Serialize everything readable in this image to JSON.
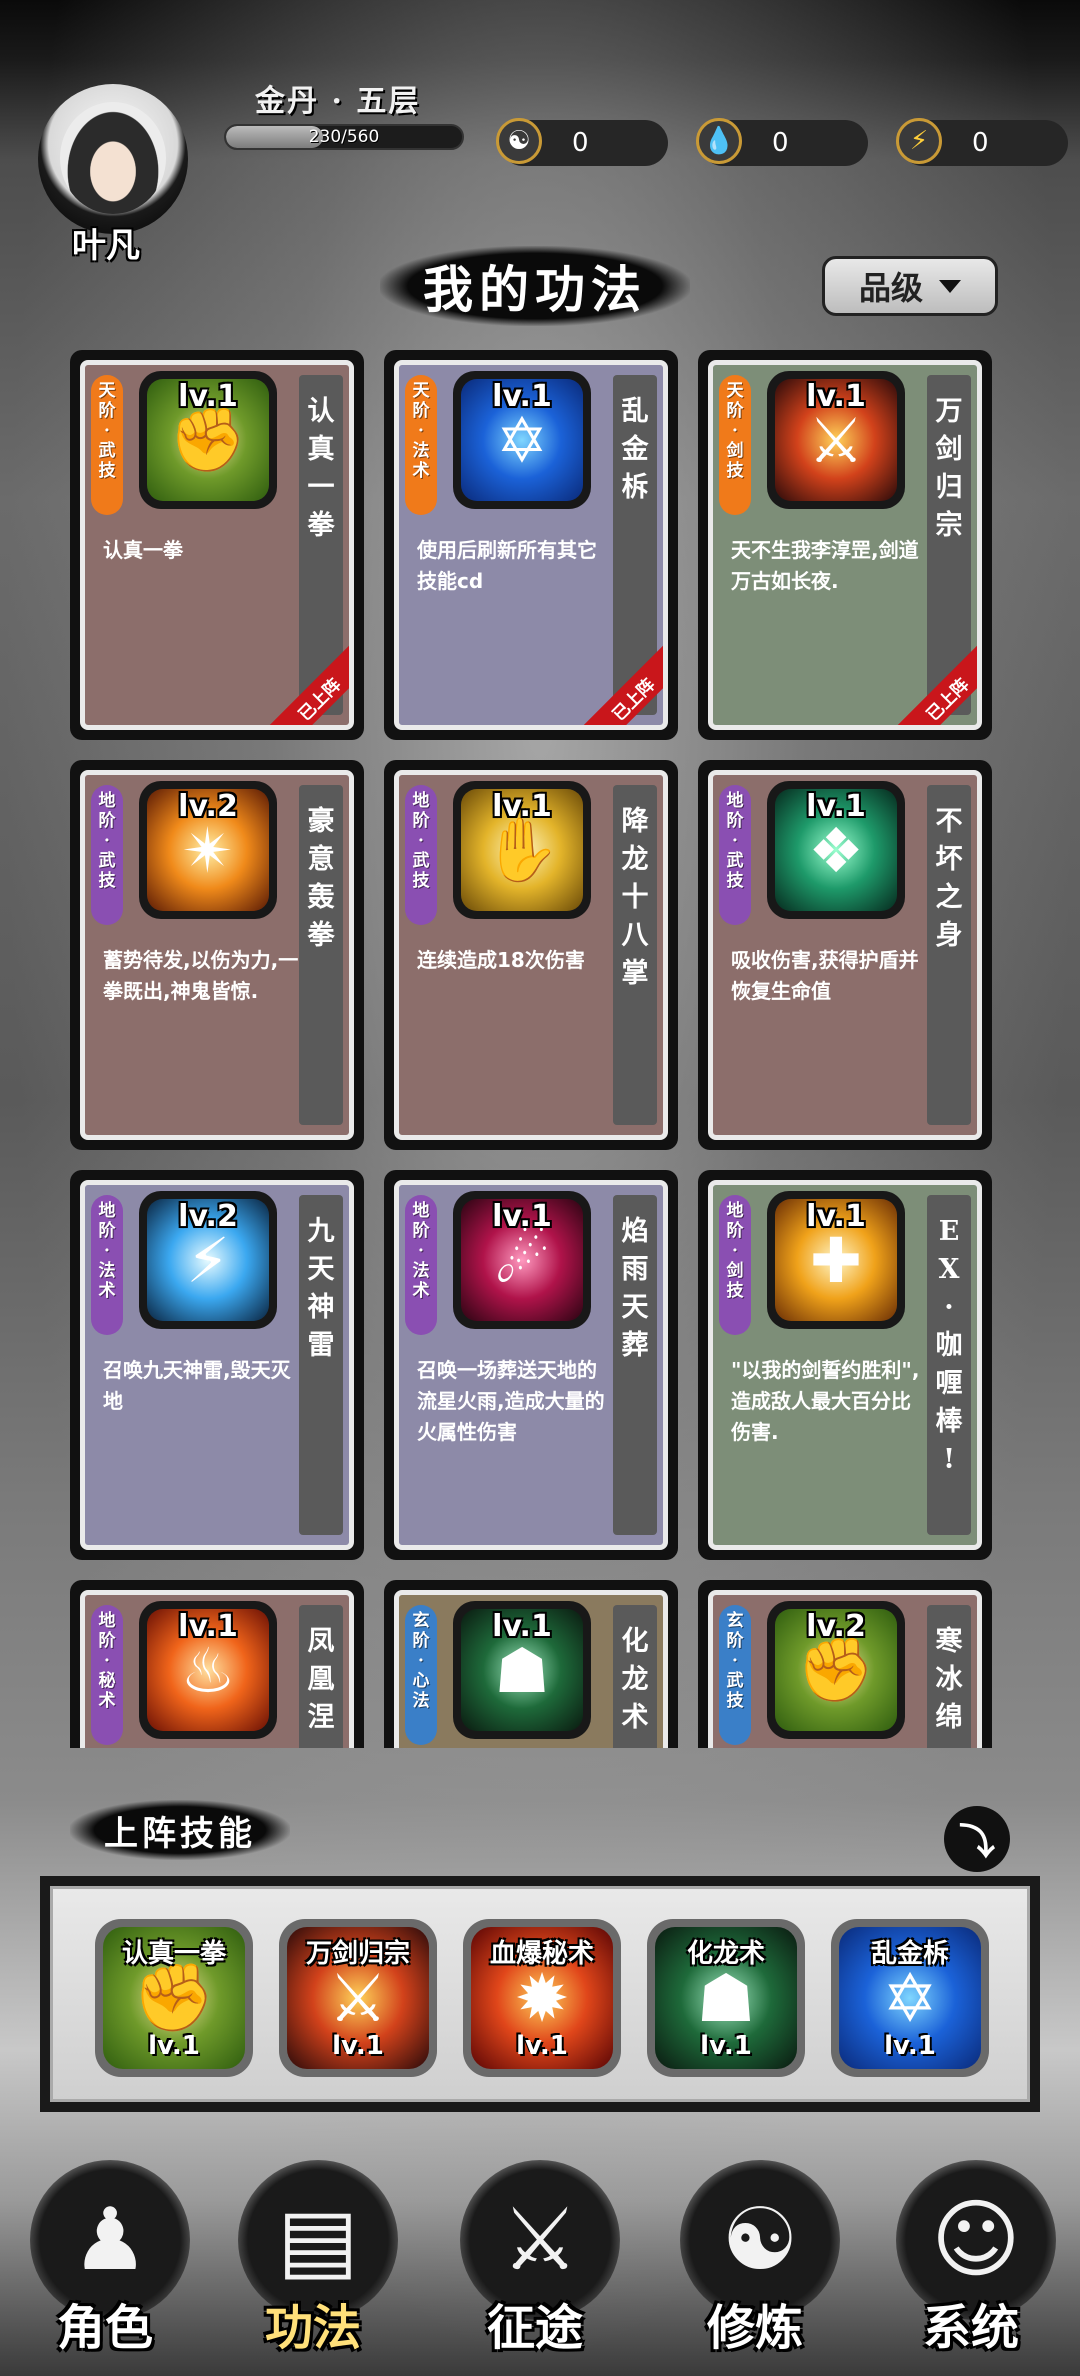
{
  "player": {
    "name": "叶凡",
    "realm": "金丹 · 五层",
    "exp_text": "230/560",
    "exp_fraction": 0.41
  },
  "currencies": [
    {
      "icon": "yin-yang-icon",
      "value": "0"
    },
    {
      "icon": "water-drop-icon",
      "value": "0"
    },
    {
      "icon": "lightning-icon",
      "value": "0"
    }
  ],
  "page": {
    "title": "我的功法",
    "sort_label": "品级"
  },
  "skills": [
    {
      "grade": [
        "天",
        "阶",
        "·",
        "武",
        "技"
      ],
      "grade_color": "#f07a1a",
      "bg": "#8c6e6b",
      "name": [
        "认",
        "真",
        "一",
        "拳"
      ],
      "level": "lv.1",
      "desc": "认真一拳",
      "icon": "fist-icon",
      "art": [
        "#f4e6a0",
        "#6f9a2a",
        "#2f5d0f"
      ],
      "glyph": "✊",
      "equipped": true,
      "equipped_label": "已上阵"
    },
    {
      "grade": [
        "天",
        "阶",
        "·",
        "法",
        "术"
      ],
      "grade_color": "#f07a1a",
      "bg": "#8d8aa8",
      "name": [
        "乱",
        "金",
        "柝"
      ],
      "level": "lv.1",
      "desc": "使用后刷新所有其它技能cd",
      "icon": "hexagram-icon",
      "art": [
        "#7fd6ff",
        "#1b62d8",
        "#0a2a7a"
      ],
      "glyph": "✡",
      "equipped": true,
      "equipped_label": "已上阵"
    },
    {
      "grade": [
        "天",
        "阶",
        "·",
        "剑",
        "技"
      ],
      "grade_color": "#f07a1a",
      "bg": "#7d8e78",
      "name": [
        "万",
        "剑",
        "归",
        "宗"
      ],
      "level": "lv.1",
      "desc": "天不生我李淳罡,剑道万古如长夜.",
      "icon": "sword-rain-icon",
      "art": [
        "#ffd35a",
        "#d2421b",
        "#2a0a0a"
      ],
      "glyph": "⚔",
      "equipped": true,
      "equipped_label": "已上阵"
    },
    {
      "grade": [
        "地",
        "阶",
        "·",
        "武",
        "技"
      ],
      "grade_color": "#8a4fb2",
      "bg": "#8c6e6b",
      "name": [
        "豪",
        "意",
        "轰",
        "拳"
      ],
      "level": "lv.2",
      "desc": "蓄势待发,以伤为力,一拳既出,神鬼皆惊.",
      "icon": "flame-burst-icon",
      "art": [
        "#fff0a8",
        "#f08a1a",
        "#5a1a05"
      ],
      "glyph": "✴",
      "equipped": false,
      "equipped_label": ""
    },
    {
      "grade": [
        "地",
        "阶",
        "·",
        "武",
        "技"
      ],
      "grade_color": "#8a4fb2",
      "bg": "#8c6e6b",
      "name": [
        "降",
        "龙",
        "十",
        "八",
        "掌"
      ],
      "level": "lv.1",
      "desc": "连续造成18次伤害",
      "icon": "palm-strike-icon",
      "art": [
        "#fff6c0",
        "#e3b42a",
        "#6a4a08"
      ],
      "glyph": "✋",
      "equipped": false,
      "equipped_label": ""
    },
    {
      "grade": [
        "地",
        "阶",
        "·",
        "武",
        "技"
      ],
      "grade_color": "#8a4fb2",
      "bg": "#8c6e6b",
      "name": [
        "不",
        "坏",
        "之",
        "身"
      ],
      "level": "lv.1",
      "desc": "吸收伤害,获得护盾并恢复生命值",
      "icon": "shield-spirit-icon",
      "art": [
        "#9cffd0",
        "#1e9a6a",
        "#062a1e"
      ],
      "glyph": "❖",
      "equipped": false,
      "equipped_label": ""
    },
    {
      "grade": [
        "地",
        "阶",
        "·",
        "法",
        "术"
      ],
      "grade_color": "#8a4fb2",
      "bg": "#8d8aa8",
      "name": [
        "九",
        "天",
        "神",
        "雷"
      ],
      "level": "lv.2",
      "desc": "召唤九天神雷,毁天灭地",
      "icon": "thunder-icon",
      "art": [
        "#e8fbff",
        "#3ba8f0",
        "#0a2440"
      ],
      "glyph": "⚡",
      "equipped": false,
      "equipped_label": ""
    },
    {
      "grade": [
        "地",
        "阶",
        "·",
        "法",
        "术"
      ],
      "grade_color": "#8a4fb2",
      "bg": "#8d8aa8",
      "name": [
        "焰",
        "雨",
        "天",
        "葬"
      ],
      "level": "lv.1",
      "desc": "召唤一场葬送天地的流星火雨,造成大量的火属性伤害",
      "icon": "meteor-rain-icon",
      "art": [
        "#ff9ac0",
        "#b0134a",
        "#2a0412"
      ],
      "glyph": "☄",
      "equipped": false,
      "equipped_label": ""
    },
    {
      "grade": [
        "地",
        "阶",
        "·",
        "剑",
        "技"
      ],
      "grade_color": "#8a4fb2",
      "bg": "#7d8e78",
      "name": [
        "E",
        "X",
        "·",
        "咖",
        "喱",
        "棒",
        "!"
      ],
      "level": "lv.1",
      "desc": "\"以我的剑誓约胜利\",造成敌人最大百分比伤害.",
      "icon": "holy-sword-icon",
      "art": [
        "#fff6c8",
        "#f0a21a",
        "#6a2e05"
      ],
      "glyph": "✚",
      "equipped": false,
      "equipped_label": ""
    },
    {
      "grade": [
        "地",
        "阶",
        "·",
        "秘",
        "术"
      ],
      "grade_color": "#8a4fb2",
      "bg": "#8c6e6b",
      "name": [
        "凤",
        "凰",
        "涅"
      ],
      "level": "lv.1",
      "desc": "",
      "icon": "phoenix-icon",
      "art": [
        "#ffe0a0",
        "#f0641a",
        "#6a1005"
      ],
      "glyph": "♨",
      "equipped": false,
      "equipped_label": ""
    },
    {
      "grade": [
        "玄",
        "阶",
        "·",
        "心",
        "法"
      ],
      "grade_color": "#3a7fc8",
      "bg": "#8a7a5e",
      "name": [
        "化",
        "龙",
        "术"
      ],
      "level": "lv.1",
      "desc": "",
      "icon": "hooded-warrior-icon",
      "art": [
        "#a0e8c0",
        "#1e6a3a",
        "#0a1a10"
      ],
      "glyph": "☗",
      "equipped": false,
      "equipped_label": ""
    },
    {
      "grade": [
        "玄",
        "阶",
        "·",
        "武",
        "技"
      ],
      "grade_color": "#3a7fc8",
      "bg": "#8c6e6b",
      "name": [
        "寒",
        "冰",
        "绵"
      ],
      "level": "lv.2",
      "desc": "",
      "icon": "fist-icon",
      "art": [
        "#f4e6a0",
        "#6f9a2a",
        "#2f5d0f"
      ],
      "glyph": "✊",
      "equipped": false,
      "equipped_label": ""
    }
  ],
  "equipped": {
    "title": "上阵技能",
    "collapse_icon": "arrow-down-icon",
    "slots": [
      {
        "name": "认真一拳",
        "level": "lv.1",
        "icon": "fist-icon",
        "art": [
          "#f4e6a0",
          "#6f9a2a",
          "#2f5d0f"
        ],
        "glyph": "✊"
      },
      {
        "name": "万剑归宗",
        "level": "lv.1",
        "icon": "sword-rain-icon",
        "art": [
          "#ffd35a",
          "#d2421b",
          "#2a0a0a"
        ],
        "glyph": "⚔"
      },
      {
        "name": "血爆秘术",
        "level": "lv.1",
        "icon": "blood-burst-icon",
        "art": [
          "#ffcf5a",
          "#e0461a",
          "#5a0505"
        ],
        "glyph": "✹"
      },
      {
        "name": "化龙术",
        "level": "lv.1",
        "icon": "hooded-warrior-icon",
        "art": [
          "#a0e8c0",
          "#1e6a3a",
          "#0a1a10"
        ],
        "glyph": "☗"
      },
      {
        "name": "乱金柝",
        "level": "lv.1",
        "icon": "hexagram-icon",
        "art": [
          "#7fd6ff",
          "#1b62d8",
          "#0a2a7a"
        ],
        "glyph": "✡"
      }
    ]
  },
  "nav": [
    {
      "label": "角色",
      "icon": "hooded-figure-icon",
      "glyph": "♟",
      "active": false
    },
    {
      "label": "功法",
      "icon": "scroll-book-icon",
      "glyph": "▤",
      "active": true
    },
    {
      "label": "征途",
      "icon": "sword-emblem-icon",
      "glyph": "⚔",
      "active": false
    },
    {
      "label": "修炼",
      "icon": "meditation-icon",
      "glyph": "☯",
      "active": false
    },
    {
      "label": "系统",
      "icon": "mascot-icon",
      "glyph": "☺",
      "active": false
    }
  ]
}
